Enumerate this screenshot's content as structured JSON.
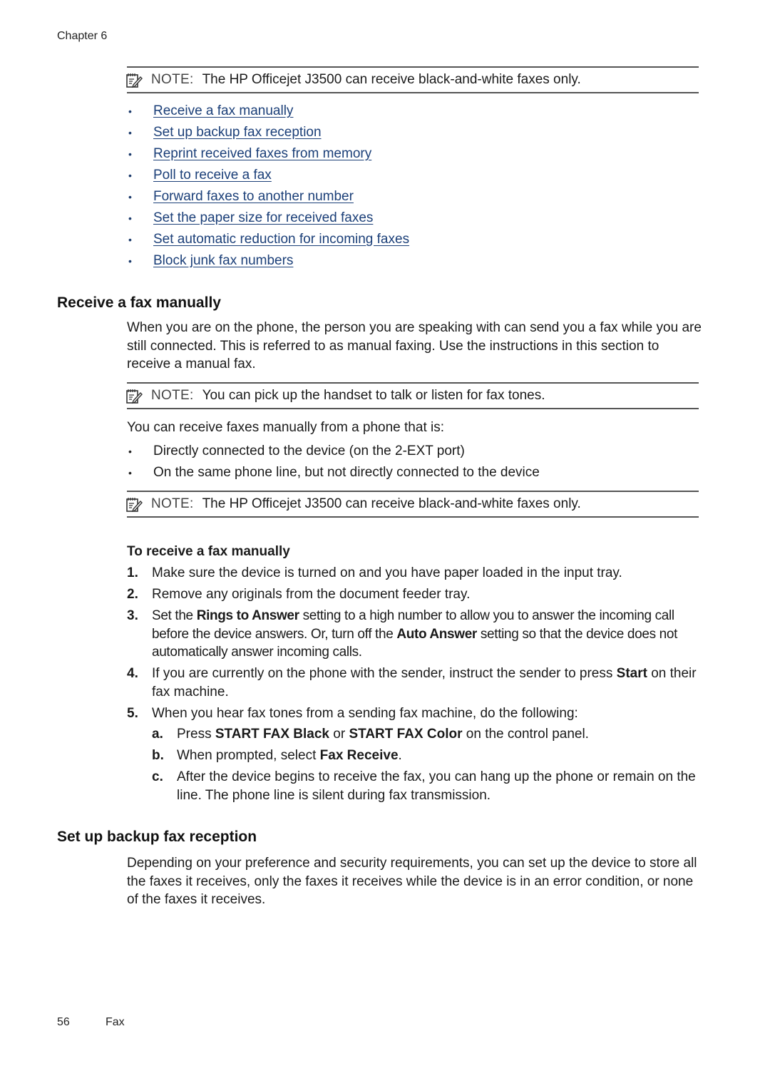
{
  "header": {
    "chapter": "Chapter 6"
  },
  "notes": [
    {
      "label": "NOTE:",
      "text": "The HP Officejet J3500 can receive black-and-white faxes only."
    },
    {
      "label": "NOTE:",
      "text": "You can pick up the handset to talk or listen for fax tones."
    },
    {
      "label": "NOTE:",
      "text": "The HP Officejet J3500 can receive black-and-white faxes only."
    }
  ],
  "links": [
    "Receive a fax manually",
    "Set up backup fax reception",
    "Reprint received faxes from memory",
    "Poll to receive a fax",
    "Forward faxes to another number",
    "Set the paper size for received faxes",
    "Set automatic reduction for incoming faxes",
    "Block junk fax numbers"
  ],
  "bullet": "•",
  "section1": {
    "title": "Receive a fax manually",
    "intro": "When you are on the phone, the person you are speaking with can send you a fax while you are still connected. This is referred to as manual faxing. Use the instructions in this section to receive a manual fax.",
    "phone_intro": "You can receive faxes manually from a phone that is:",
    "phone_options": [
      "Directly connected to the device (on the 2-EXT port)",
      "On the same phone line, but not directly connected to the device"
    ],
    "procedure_title": "To receive a fax manually",
    "steps": {
      "s1": {
        "num": "1.",
        "text": "Make sure the device is turned on and you have paper loaded in the input tray."
      },
      "s2": {
        "num": "2.",
        "text": "Remove any originals from the document feeder tray."
      },
      "s3": {
        "num": "3.",
        "t1": "Set the ",
        "b1": "Rings to Answer",
        "t2": " setting to a high number to allow you to answer the incoming call before the device answers. Or, turn off the ",
        "b2": "Auto Answer",
        "t3": " setting so that the device does not automatically answer incoming calls."
      },
      "s4": {
        "num": "4.",
        "t1": "If you are currently on the phone with the sender, instruct the sender to press ",
        "b1": "Start",
        "t2": " on their fax machine."
      },
      "s5": {
        "num": "5.",
        "text": "When you hear fax tones from a sending fax machine, do the following:",
        "a": {
          "let": "a.",
          "t1": "Press ",
          "b1": "START FAX Black",
          "t2": " or ",
          "b2": "START FAX Color",
          "t3": " on the control panel."
        },
        "b": {
          "let": "b.",
          "t1": "When prompted, select ",
          "b1": "Fax Receive",
          "t2": "."
        },
        "c": {
          "let": "c.",
          "text": "After the device begins to receive the fax, you can hang up the phone or remain on the line. The phone line is silent during fax transmission."
        }
      }
    }
  },
  "section2": {
    "title": "Set up backup fax reception",
    "intro": "Depending on your preference and security requirements, you can set up the device to store all the faxes it receives, only the faxes it receives while the device is in an error condition, or none of the faxes it receives."
  },
  "footer": {
    "page": "56",
    "section": "Fax"
  },
  "colors": {
    "link": "#1b3f78",
    "rule": "#555555"
  }
}
